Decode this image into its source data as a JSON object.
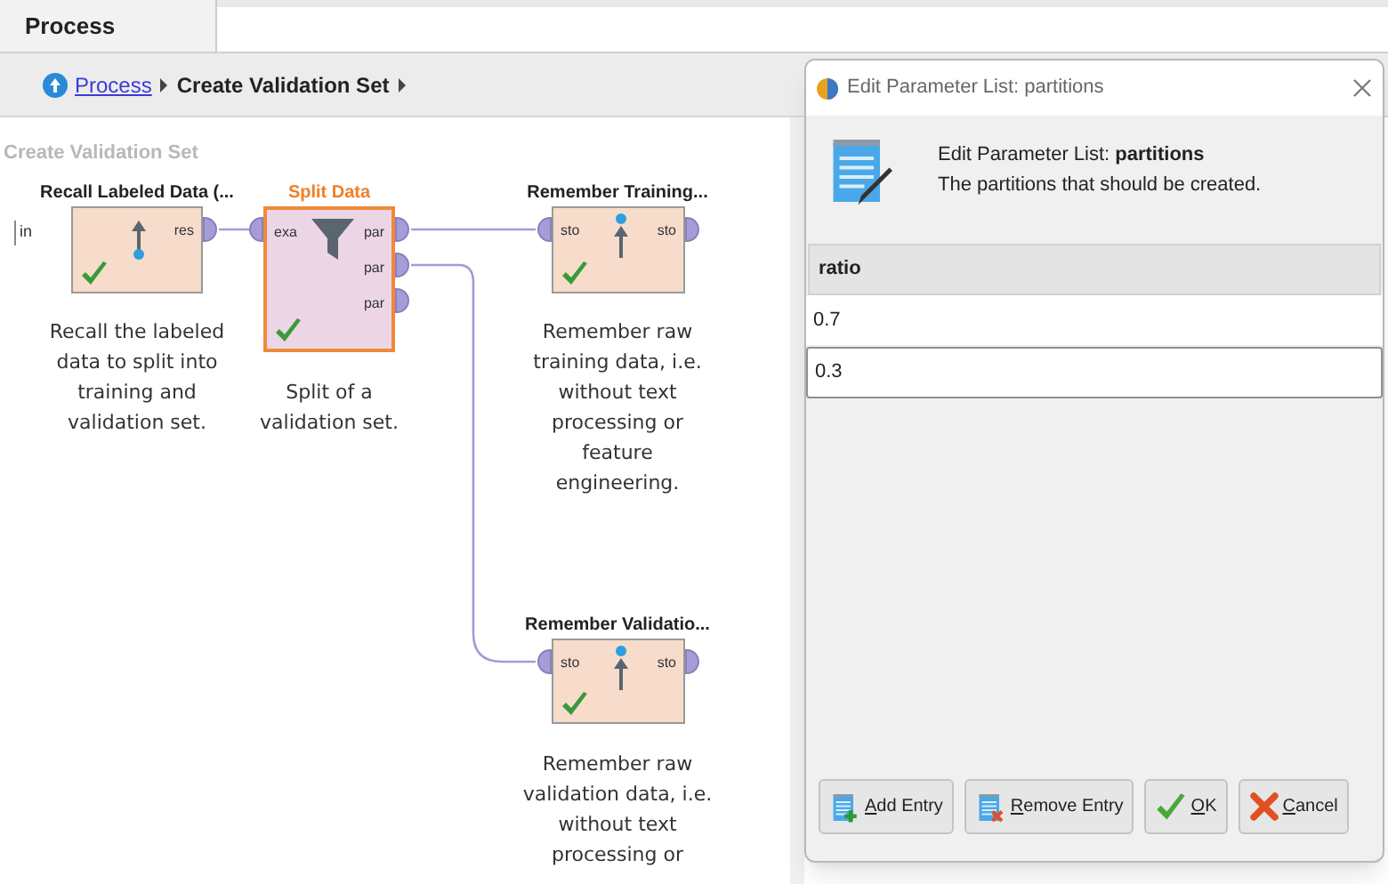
{
  "tabs": [
    {
      "label": "Process",
      "selected": true
    }
  ],
  "breadcrumb": {
    "items": [
      {
        "label": "Process",
        "kind": "link"
      },
      {
        "label": "Create Validation Set",
        "kind": "current"
      }
    ]
  },
  "canvas": {
    "title": "Create Validation Set",
    "input_port": "in",
    "nodes": [
      {
        "title": "Recall Labeled Data (...",
        "selected": false,
        "checked": true,
        "kind": "recall",
        "outputs": [
          "res"
        ],
        "description": "Recall the labeled data to split into training and validation set."
      },
      {
        "title": "Split Data",
        "selected": true,
        "checked": true,
        "kind": "split",
        "inputs": [
          "exa"
        ],
        "outputs": [
          "par",
          "par",
          "par"
        ],
        "description": "Split of a validation set."
      },
      {
        "title": "Remember Training...",
        "selected": false,
        "checked": true,
        "kind": "remember",
        "inputs": [
          "sto"
        ],
        "outputs": [
          "sto"
        ],
        "description": "Remember raw training data, i.e. without text processing or feature engineering."
      },
      {
        "title": "Remember Validatio...",
        "selected": false,
        "checked": true,
        "kind": "remember",
        "inputs": [
          "sto"
        ],
        "outputs": [
          "sto"
        ],
        "description": "Remember raw validation data, i.e. without text processing or"
      }
    ]
  },
  "dialog": {
    "title": "Edit Parameter List: partitions",
    "header": {
      "title": "Edit Parameter List: **partitions**",
      "description": "The partitions that should be created."
    },
    "table": {
      "columns": [
        "ratio"
      ],
      "rows": [
        {
          "value": "0.7",
          "selected": false
        },
        {
          "value": "0.3",
          "selected": true
        }
      ]
    },
    "buttons": [
      {
        "label": "Add Entry",
        "kind": "add"
      },
      {
        "label": "Remove Entry",
        "kind": "remove"
      },
      {
        "label": "OK",
        "kind": "ok"
      },
      {
        "label": "Cancel",
        "kind": "cancel"
      }
    ]
  }
}
